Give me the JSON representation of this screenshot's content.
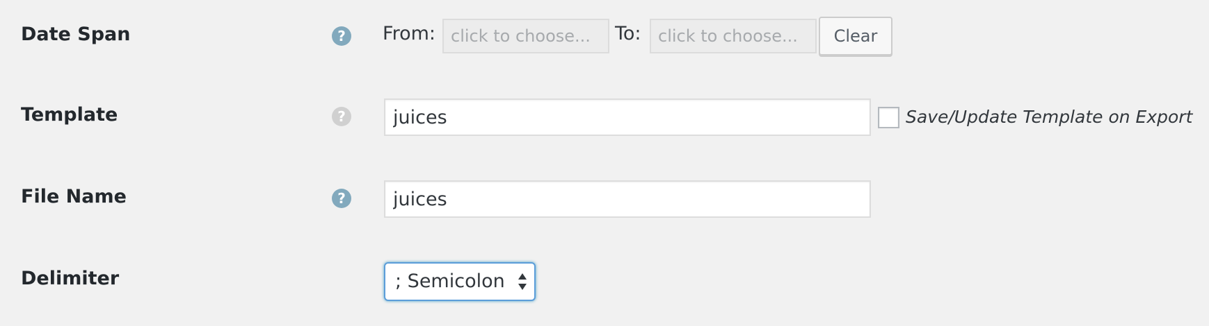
{
  "form": {
    "date_span": {
      "label": "Date Span",
      "help_icon": "question-circle-icon",
      "from_label": "From:",
      "from_placeholder": "click to choose...",
      "from_value": "",
      "to_label": "To:",
      "to_placeholder": "click to choose...",
      "to_value": "",
      "clear_label": "Clear"
    },
    "template": {
      "label": "Template",
      "help_icon": "question-circle-icon",
      "value": "juices",
      "checkbox_label": "Save/Update Template on Export",
      "checkbox_checked": false
    },
    "file_name": {
      "label": "File Name",
      "help_icon": "question-circle-icon",
      "value": "juices"
    },
    "delimiter": {
      "label": "Delimiter",
      "selected": "; Semicolon",
      "arrows_icon": "select-arrows-icon"
    }
  },
  "colors": {
    "help_active": "#82a9bd",
    "help_inactive": "#d0d0d0",
    "focus_border": "#5b9dd9",
    "background": "#f1f1f1"
  }
}
